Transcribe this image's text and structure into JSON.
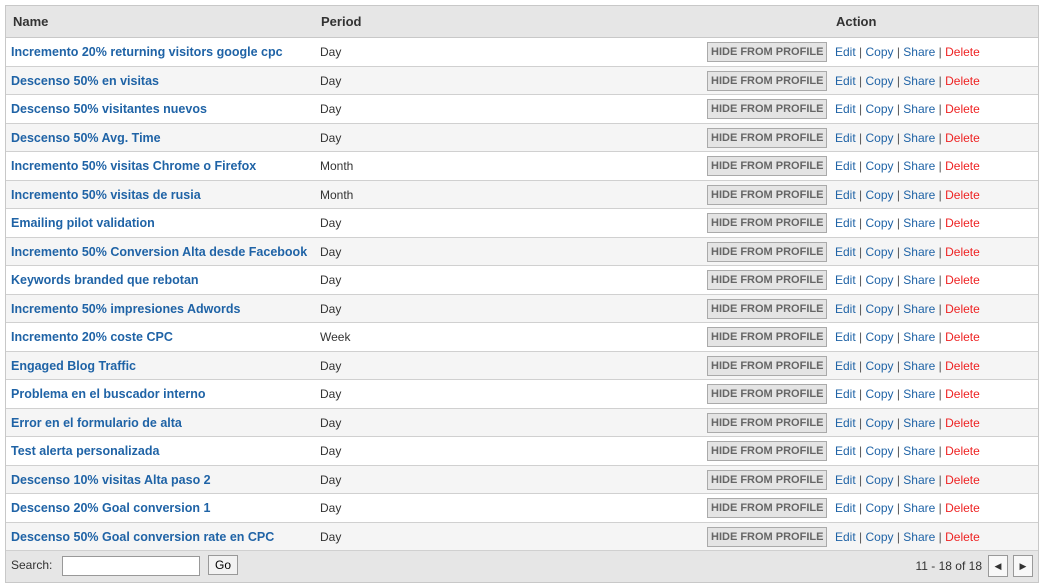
{
  "header": {
    "name": "Name",
    "period": "Period",
    "action": "Action"
  },
  "actions": {
    "hide": "HIDE FROM PROFILE",
    "edit": "Edit",
    "copy": "Copy",
    "share": "Share",
    "delete": "Delete",
    "sep": " | "
  },
  "rows": [
    {
      "name": "Incremento 20% returning visitors google cpc",
      "period": "Day"
    },
    {
      "name": "Descenso 50% en visitas",
      "period": "Day"
    },
    {
      "name": "Descenso 50% visitantes nuevos",
      "period": "Day"
    },
    {
      "name": "Descenso 50% Avg. Time",
      "period": "Day"
    },
    {
      "name": "Incremento 50% visitas Chrome o Firefox",
      "period": "Month"
    },
    {
      "name": "Incremento 50% visitas de rusia",
      "period": "Month"
    },
    {
      "name": "Emailing pilot validation",
      "period": "Day"
    },
    {
      "name": "Incremento 50% Conversion Alta desde Facebook",
      "period": "Day"
    },
    {
      "name": "Keywords branded que rebotan",
      "period": "Day"
    },
    {
      "name": "Incremento 50% impresiones Adwords",
      "period": "Day"
    },
    {
      "name": "Incremento 20% coste CPC",
      "period": "Week"
    },
    {
      "name": "Engaged Blog Traffic",
      "period": "Day"
    },
    {
      "name": "Problema en el buscador interno",
      "period": "Day"
    },
    {
      "name": "Error en el formulario de alta",
      "period": "Day"
    },
    {
      "name": "Test alerta personalizada",
      "period": "Day"
    },
    {
      "name": "Descenso 10% visitas Alta paso 2",
      "period": "Day"
    },
    {
      "name": "Descenso 20% Goal conversion 1",
      "period": "Day"
    },
    {
      "name": "Descenso 50% Goal conversion rate en CPC",
      "period": "Day"
    }
  ],
  "footer": {
    "search_label": "Search:",
    "search_value": "",
    "go": "Go",
    "pagination": "11 - 18 of 18",
    "prev_icon": "◀",
    "next_icon": "▶"
  }
}
